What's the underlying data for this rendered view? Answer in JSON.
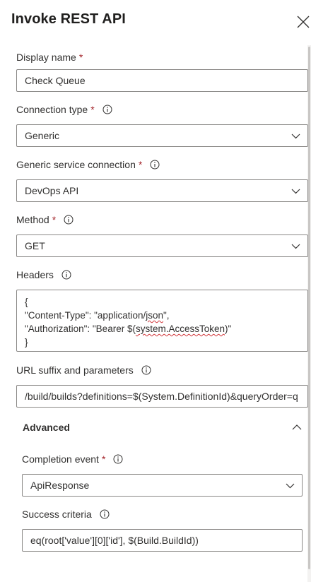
{
  "panel": {
    "title": "Invoke REST API"
  },
  "fields": {
    "display_name": {
      "label": "Display name",
      "required_mark": "*",
      "value": "Check Queue"
    },
    "connection_type": {
      "label": "Connection type",
      "required_mark": "*",
      "value": "Generic"
    },
    "service_connection": {
      "label": "Generic service connection",
      "required_mark": "*",
      "value": "DevOps API"
    },
    "method": {
      "label": "Method",
      "required_mark": "*",
      "value": "GET"
    },
    "headers": {
      "label": "Headers",
      "line1": "{",
      "line2_prefix": "\"Content-Type\": \"application/",
      "line2_squiggle": "json",
      "line2_suffix": "\",",
      "line3_prefix": "\"Authorization\": \"Bearer $(",
      "line3_squiggle": "system.AccessToken",
      "line3_suffix": ")\"",
      "line4": "}"
    },
    "url_suffix": {
      "label": "URL suffix and parameters",
      "value": "/build/builds?definitions=$(System.DefinitionId)&queryOrder=q"
    }
  },
  "advanced": {
    "label": "Advanced",
    "completion_event": {
      "label": "Completion event",
      "required_mark": "*",
      "value": "ApiResponse"
    },
    "success_criteria": {
      "label": "Success criteria",
      "value": "eq(root['value'][0]['id'], $(Build.BuildId))"
    }
  },
  "icons": {
    "close": "close-icon",
    "info": "info-icon",
    "chevron_down": "chevron-down-icon",
    "chevron_up": "chevron-up-icon"
  },
  "colors": {
    "required": "#a4262c",
    "border": "#8a8886",
    "text": "#323130",
    "spell_error": "#d13438"
  }
}
